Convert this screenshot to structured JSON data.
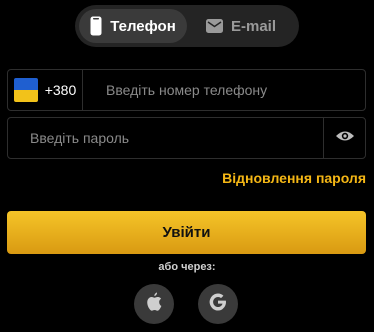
{
  "tabs": [
    {
      "label": "Телефон",
      "icon": "smartphone-icon",
      "active": true
    },
    {
      "label": "E-mail",
      "icon": "envelope-icon",
      "active": false
    }
  ],
  "phone": {
    "country_flag": "ukraine-flag-icon",
    "prefix": "+380",
    "placeholder": "Введіть номер телефону",
    "value": ""
  },
  "password": {
    "placeholder": "Введіть пароль",
    "value": "",
    "toggle_icon": "eye-icon"
  },
  "recover_link": "Відновлення пароля",
  "login_button": "Увійти",
  "or_label": "або через:",
  "social": [
    {
      "icon": "apple-icon"
    },
    {
      "icon": "google-icon"
    }
  ],
  "colors": {
    "background": "#000000",
    "accent": "#f5b715",
    "button_gradient_top": "#f5c428",
    "button_gradient_bottom": "#d99a12",
    "field_border": "#2e2e2e",
    "tab_bar": "#242424"
  }
}
